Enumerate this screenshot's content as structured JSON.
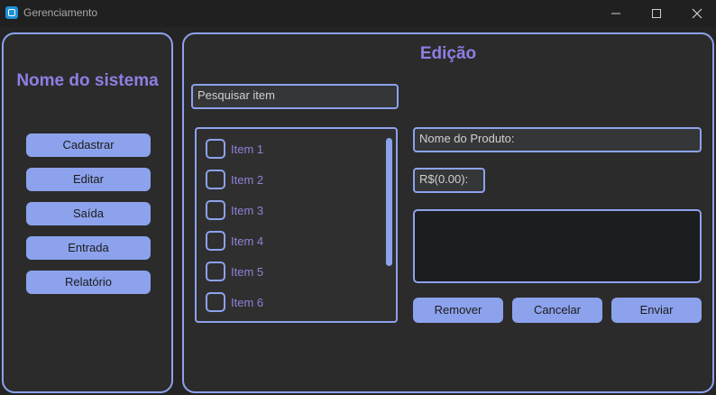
{
  "window": {
    "title": "Gerenciamento",
    "icons": [
      "app-icon",
      "minimize-icon",
      "maximize-icon",
      "close-icon"
    ]
  },
  "sidebar": {
    "system_name": "Nome do sistema",
    "buttons": [
      "Cadastrar",
      "Editar",
      "Saída",
      "Entrada",
      "Relatório"
    ]
  },
  "main": {
    "title": "Edição",
    "search_placeholder": "Pesquisar item",
    "items": [
      "Item 1",
      "Item 2",
      "Item 3",
      "Item 4",
      "Item 5",
      "Item 6"
    ],
    "product_name_placeholder": "Nome do Produto:",
    "price_placeholder": "R$(0.00):",
    "actions": [
      "Remover",
      "Cancelar",
      "Enviar"
    ]
  },
  "colors": {
    "accent": "#8ca2ec",
    "heading": "#8d7fe3",
    "background": "#242424",
    "panel": "#2b2b2b"
  }
}
